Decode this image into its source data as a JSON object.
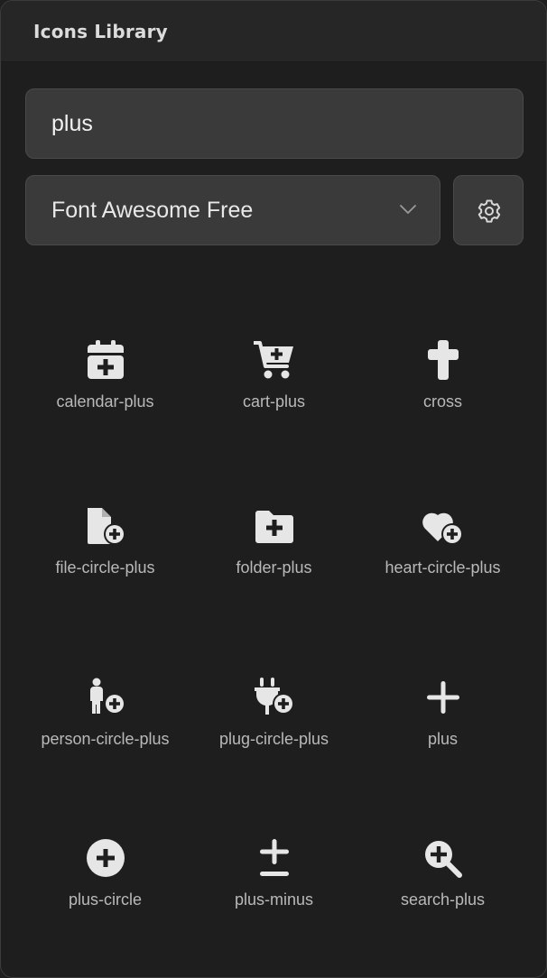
{
  "header": {
    "title": "Icons Library"
  },
  "search": {
    "value": "plus"
  },
  "library_select": {
    "selected": "Font Awesome Free"
  },
  "settings": {
    "icon": "gear-icon"
  },
  "icons": [
    {
      "label": "calendar-plus",
      "icon": "calendar-plus-icon"
    },
    {
      "label": "cart-plus",
      "icon": "cart-plus-icon"
    },
    {
      "label": "cross",
      "icon": "cross-icon"
    },
    {
      "label": "file-circle-plus",
      "icon": "file-circle-plus-icon"
    },
    {
      "label": "folder-plus",
      "icon": "folder-plus-icon"
    },
    {
      "label": "heart-circle-plus",
      "icon": "heart-circle-plus-icon"
    },
    {
      "label": "person-circle-plus",
      "icon": "person-circle-plus-icon"
    },
    {
      "label": "plug-circle-plus",
      "icon": "plug-circle-plus-icon"
    },
    {
      "label": "plus",
      "icon": "plus-icon"
    },
    {
      "label": "plus-circle",
      "icon": "plus-circle-icon"
    },
    {
      "label": "plus-minus",
      "icon": "plus-minus-icon"
    },
    {
      "label": "search-plus",
      "icon": "search-plus-icon"
    }
  ],
  "colors": {
    "background": "#1e1e1e",
    "header": "#262626",
    "field": "#3a3a3a",
    "icon": "#e6e6e6",
    "label": "#b9b9b9"
  }
}
